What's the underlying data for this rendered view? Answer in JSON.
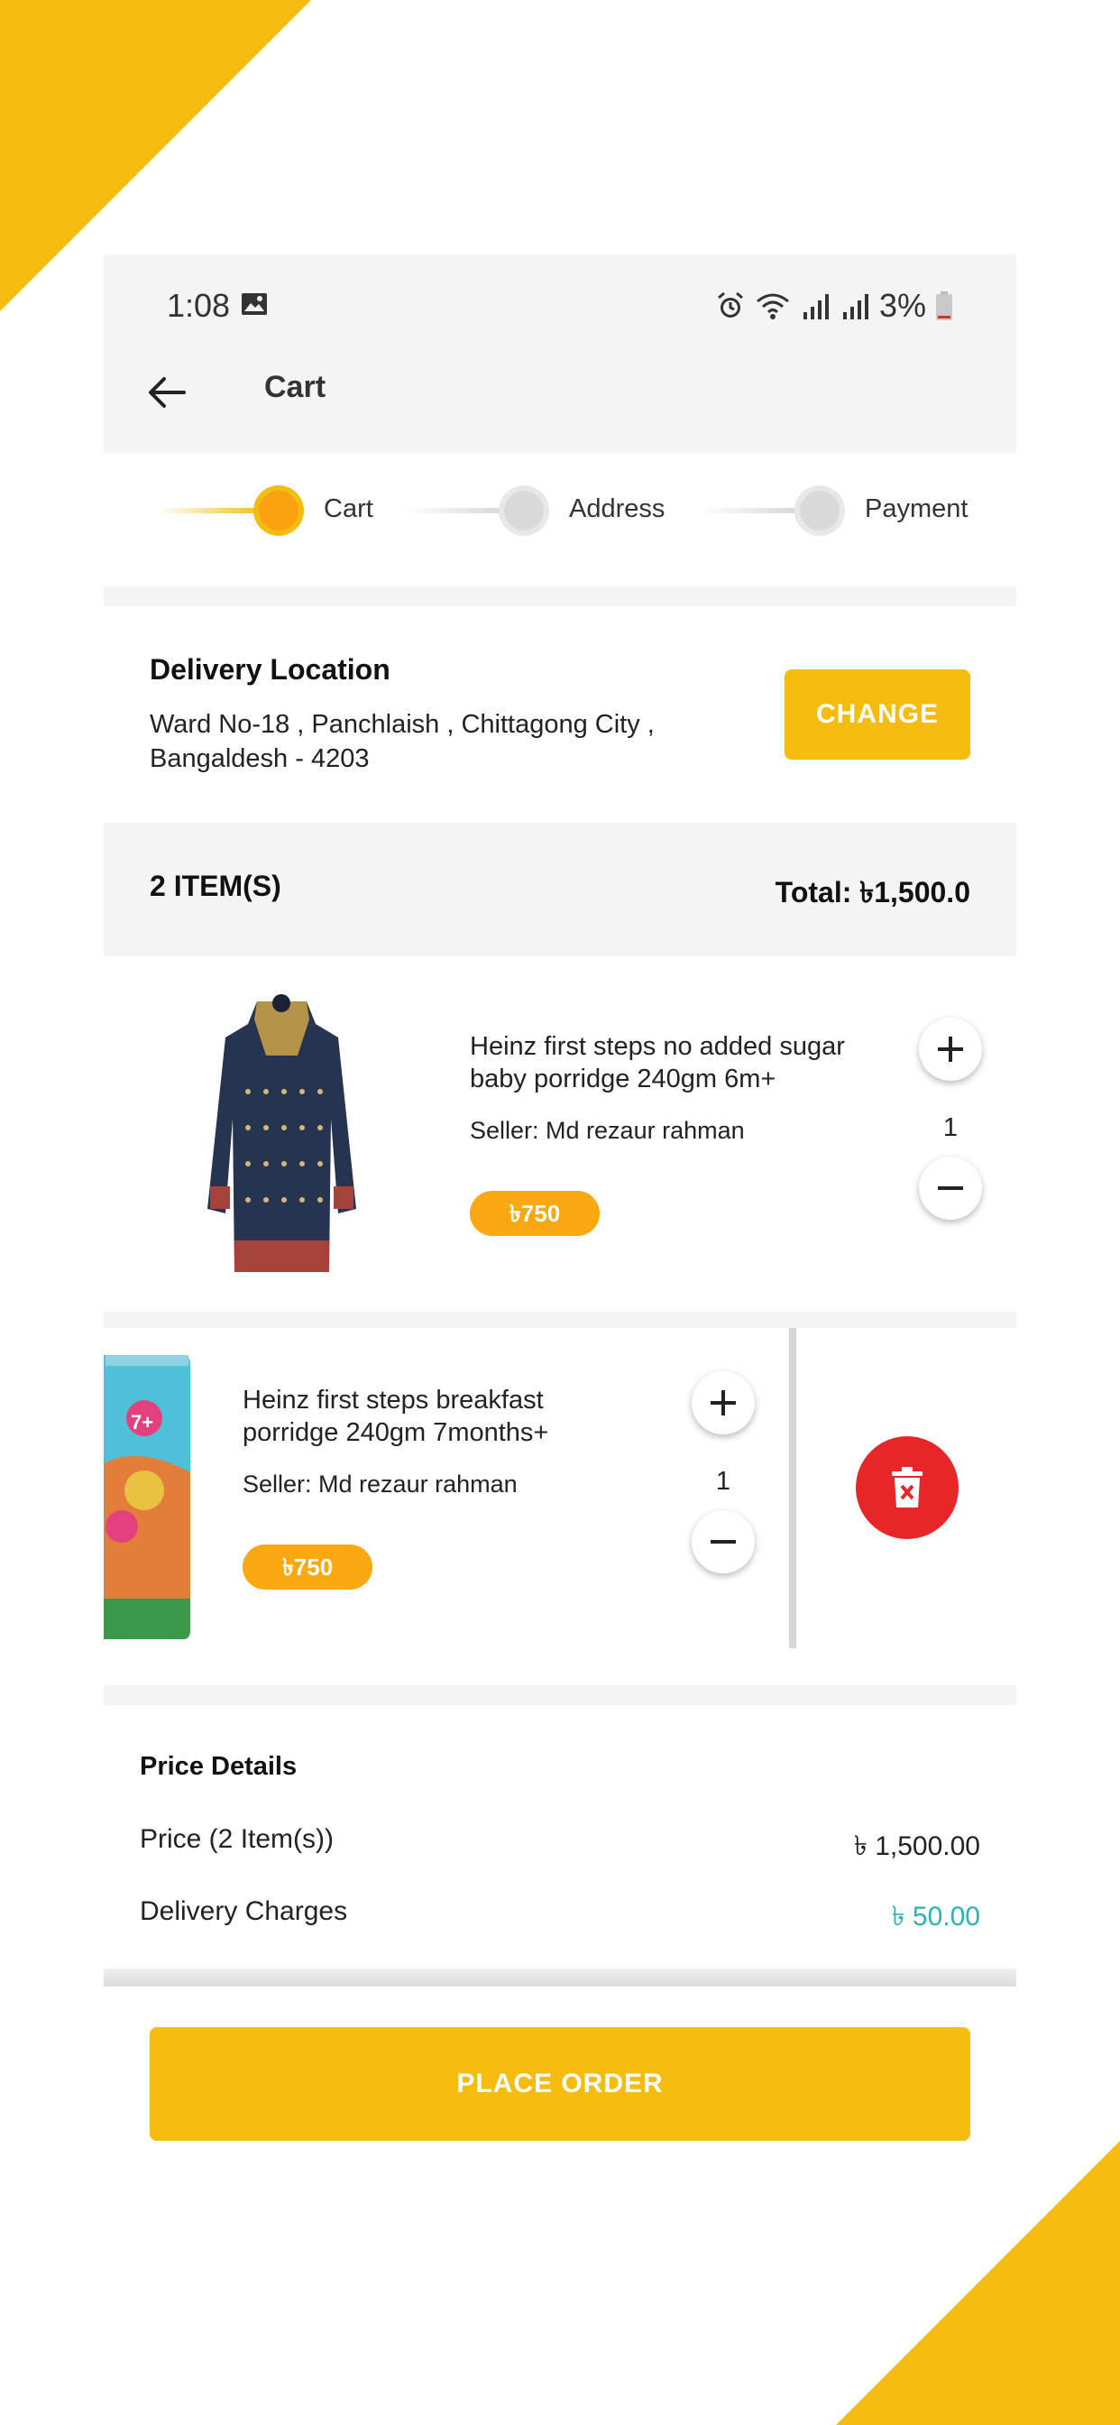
{
  "status_bar": {
    "time": "1:08",
    "battery": "3%"
  },
  "app_bar": {
    "title": "Cart"
  },
  "stepper": {
    "steps": [
      "Cart",
      "Address",
      "Payment"
    ],
    "active_index": 0
  },
  "delivery": {
    "title": "Delivery Location",
    "address": "Ward No-18 , Panchlaish ,  Chittagong City , Bangaldesh - 4203",
    "change_label": "CHANGE"
  },
  "summary": {
    "items_label": "2  ITEM(S)",
    "total_label": "Total: ৳1,500.0"
  },
  "items": [
    {
      "name": "Heinz first steps no added sugar baby porridge 240gm 6m+",
      "seller": "Seller: Md rezaur rahman",
      "price": "৳750",
      "quantity": "1"
    },
    {
      "name": "Heinz first steps breakfast porridge 240gm 7months+",
      "seller": "Seller: Md rezaur rahman",
      "price": "৳750",
      "quantity": "1",
      "product_badge": "7+"
    }
  ],
  "price_details": {
    "title": "Price Details",
    "rows": [
      {
        "label": "Price (2 Item(s))",
        "value": "৳ 1,500.00"
      },
      {
        "label": "Delivery Charges",
        "value": "৳ 50.00"
      }
    ]
  },
  "place_order_label": "PLACE ORDER",
  "colors": {
    "accent": "#f3bc0e",
    "price_badge": "#f9a80f",
    "delete": "#e8262a",
    "delivery_charge": "#2bb3b1"
  },
  "icons": [
    "gallery-icon",
    "alarm-icon",
    "wifi-icon",
    "signal-icon",
    "battery-icon",
    "back-arrow-icon",
    "plus-icon",
    "minus-icon",
    "trash-icon"
  ]
}
